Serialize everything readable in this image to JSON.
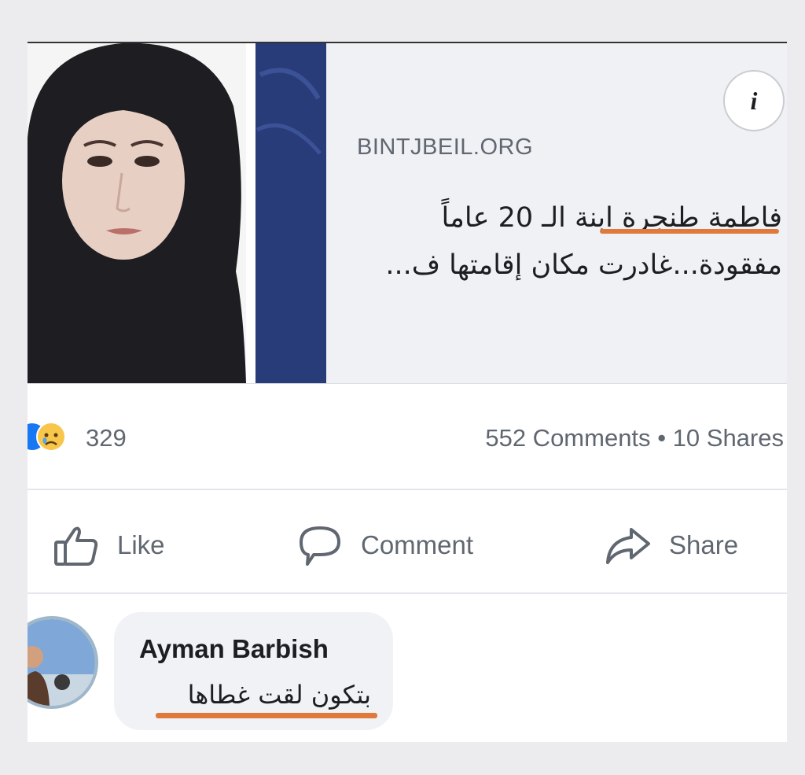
{
  "post": {
    "link_preview": {
      "domain": "BINTJBEIL.ORG",
      "headline_line1": "فاطمة طنجرة ابنة الـ 20 عاماً",
      "headline_line2": "مفقودة...غادرت مكان إقامتها ف...",
      "info_symbol": "i"
    },
    "reactions": {
      "count": "329",
      "icons": [
        "like-icon",
        "sad-reaction-icon"
      ]
    },
    "stats": {
      "comments": "552 Comments",
      "separator": "•",
      "shares": "10 Shares"
    },
    "actions": {
      "like_label": "Like",
      "comment_label": "Comment",
      "share_label": "Share"
    },
    "comment": {
      "author": "Ayman Barbish",
      "text": "بتكون لقت غطاها"
    }
  },
  "colors": {
    "highlight_underline": "#e07a3c",
    "secondary_text": "#606770",
    "primary_text": "#1c1e21",
    "preview_bg": "#f0f1f4"
  }
}
